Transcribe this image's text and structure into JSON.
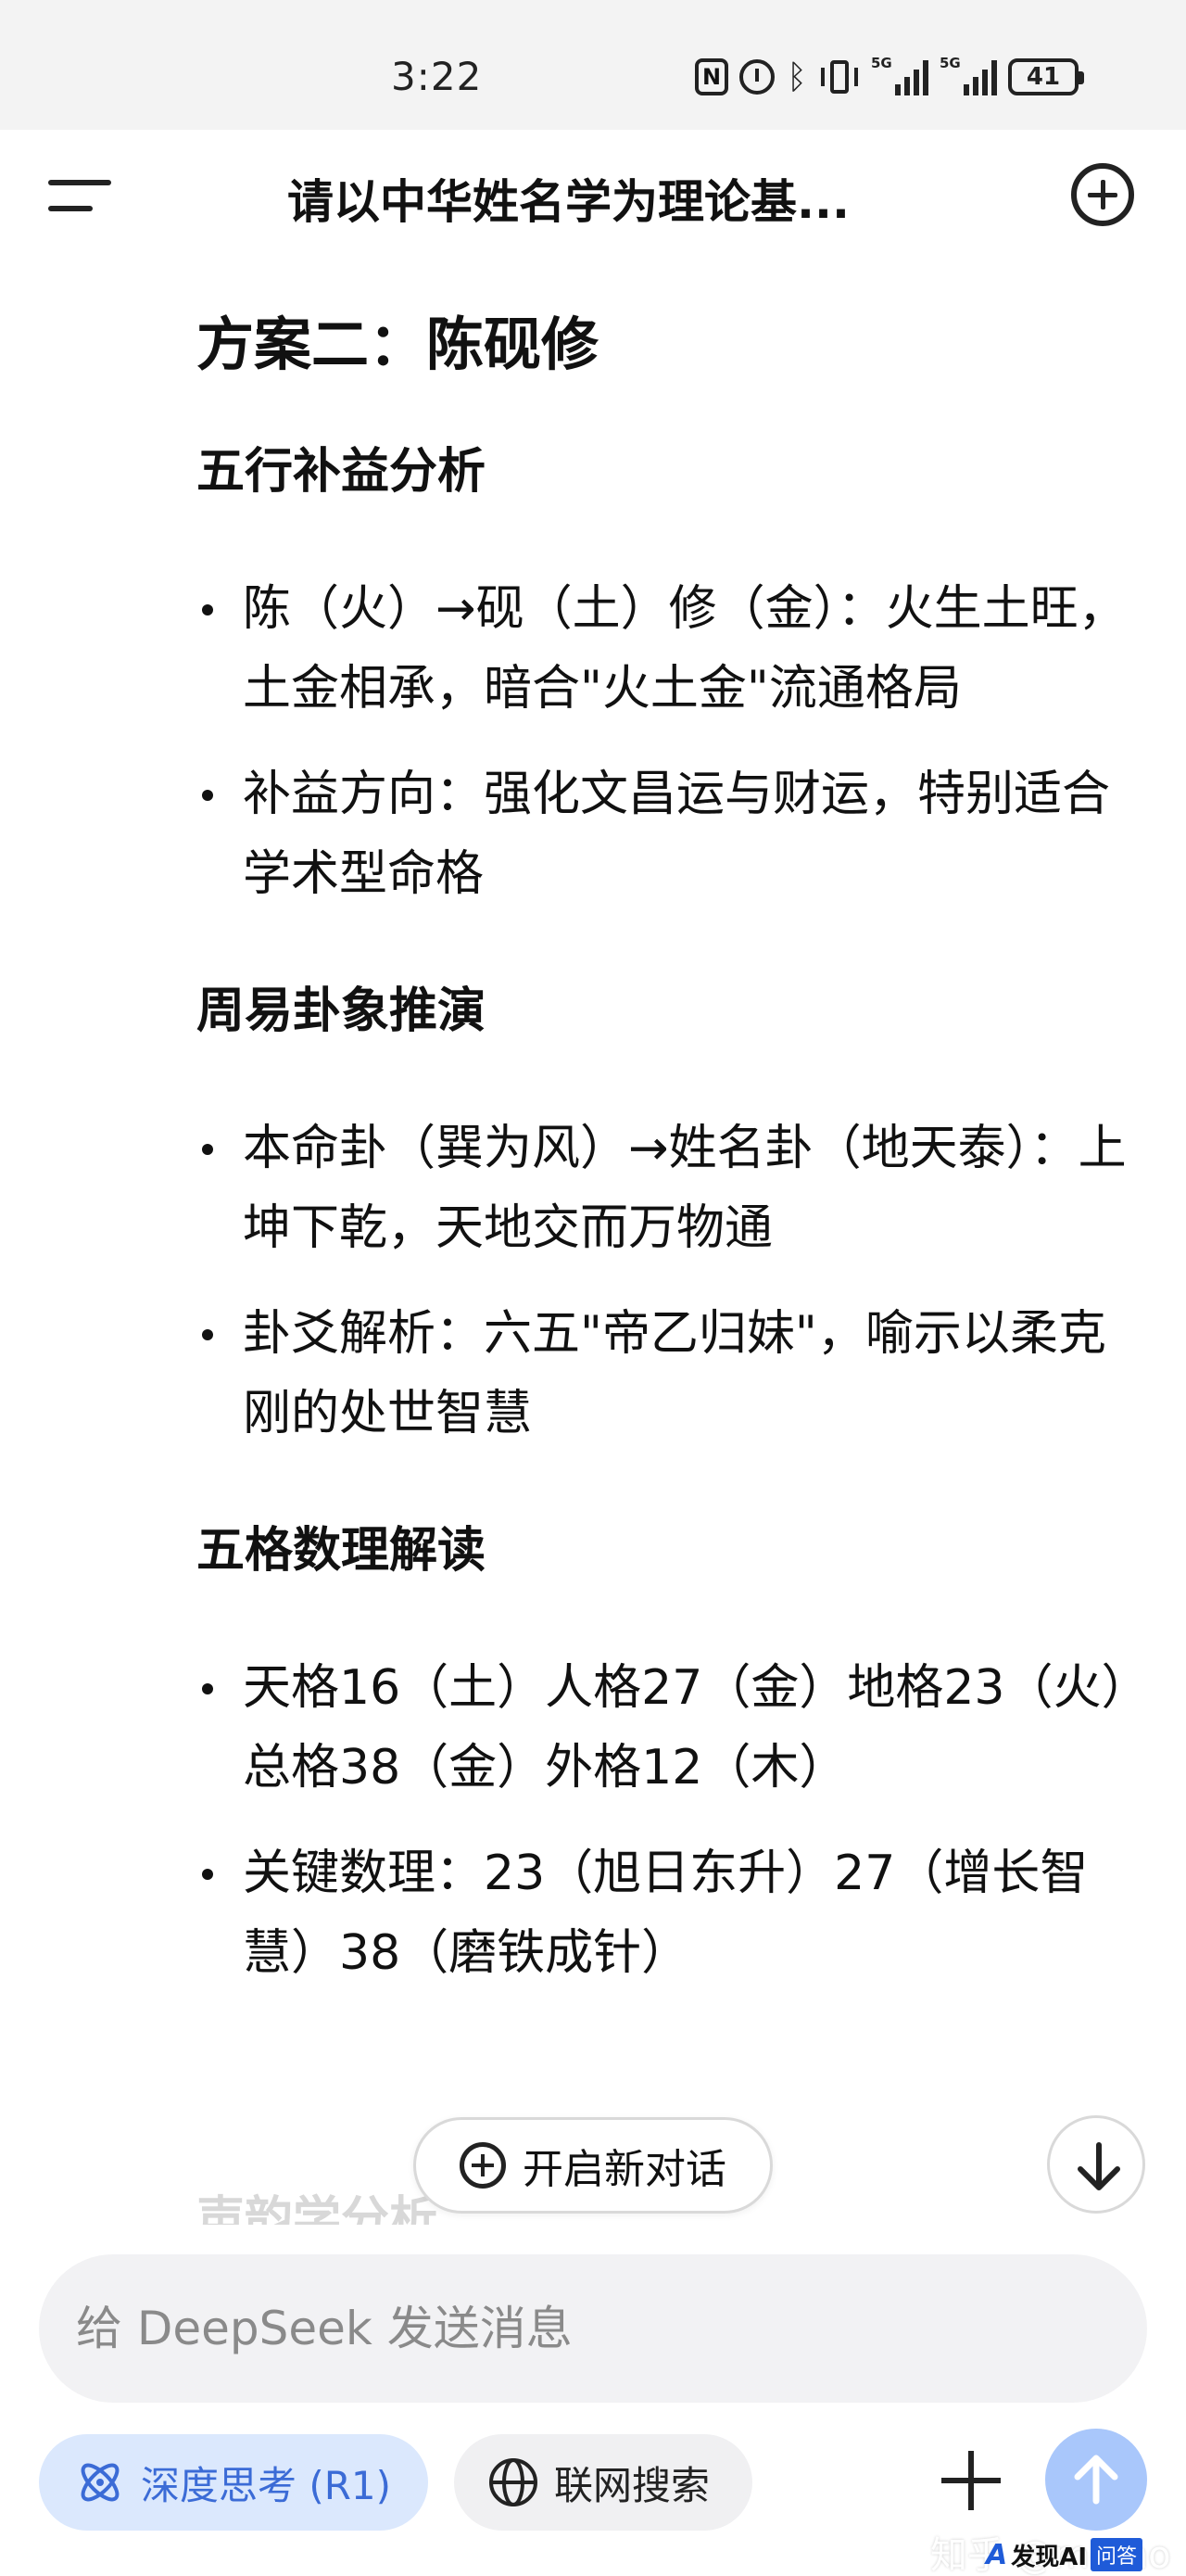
{
  "status_bar": {
    "time": "3:22",
    "signal1_label": "5G",
    "signal2_label": "5G",
    "battery": "41",
    "icons": [
      "nfc-icon",
      "alarm-icon",
      "bluetooth-icon",
      "vibrate-icon",
      "signal-icon",
      "signal-icon",
      "battery-icon"
    ]
  },
  "header": {
    "title": "请以中华姓名学为理论基..."
  },
  "content": {
    "heading": "方案二：陈砚修",
    "sections": [
      {
        "title": "五行补益分析",
        "bullets": [
          "陈（火）→砚（土）修（金）：火生土旺，土金相承，暗合\"火土金\"流通格局",
          "补益方向：强化文昌运与财运，特别适合学术型命格"
        ]
      },
      {
        "title": "周易卦象推演",
        "bullets": [
          "本命卦（巽为风）→姓名卦（地天泰）：上坤下乾，天地交而万物通",
          "卦爻解析：六五\"帝乙归妹\"，喻示以柔克刚的处世智慧"
        ]
      },
      {
        "title": "五格数理解读",
        "bullets": [
          "天格16（土）人格27（金）地格23（火）总格38（金）外格12（木）",
          "关键数理：23（旭日东升）27（增长智慧）38（磨铁成针）"
        ]
      }
    ],
    "faded_next_title": "声韵学分析"
  },
  "floating": {
    "new_dialog_label": "开启新对话"
  },
  "composer": {
    "placeholder": "给 DeepSeek 发送消息",
    "deep_think_label": "深度思考 (R1)",
    "web_search_label": "联网搜索"
  },
  "colors": {
    "accent_blue": "#3b6bd6",
    "deep_think_bg": "#dbe8fd",
    "send_button": "#a9c7fb",
    "input_bg": "#f2f2f4",
    "status_bar_bg": "#f3f3f3"
  },
  "watermark": {
    "zhihu": "知乎 @momo",
    "brand": "发现AI",
    "tag": "问答"
  }
}
